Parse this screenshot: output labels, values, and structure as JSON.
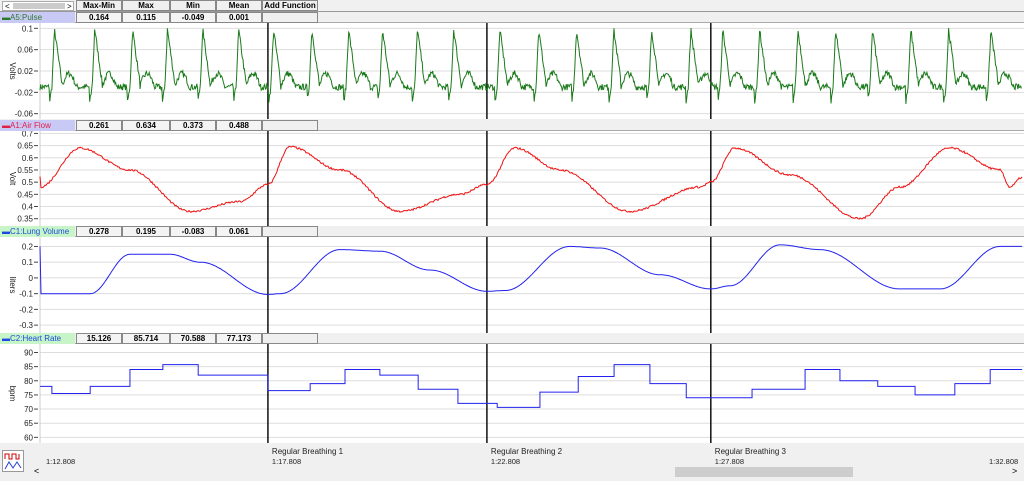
{
  "toolbar": {
    "columns": [
      "Max-Min",
      "Max",
      "Min",
      "Mean",
      "Add Function"
    ],
    "scroll_left": "<",
    "scroll_right": ">"
  },
  "time_range": [
    72.808,
    92.808
  ],
  "channels": [
    {
      "label": "A5:Pulse",
      "label_color": "#2a7a2a",
      "header_bg": "#c9c9f5",
      "values": [
        "0.164",
        "0.115",
        "-0.049",
        "0.001"
      ],
      "unit": "Volts",
      "color": "#1a7a1a",
      "ylim": [
        -0.07,
        0.11
      ],
      "ticks": [
        "0.1",
        "0.06",
        "0.02",
        "-0.02",
        "-0.06"
      ],
      "tick_values": [
        0.1,
        0.06,
        0.02,
        -0.02,
        -0.06
      ],
      "beats": [
        73.05,
        73.87,
        74.64,
        75.35,
        76.07,
        76.8,
        77.51,
        78.29,
        79.04,
        79.73,
        80.44,
        81.18,
        82.12,
        82.91,
        83.68,
        84.44,
        85.21,
        86.01,
        86.66,
        87.41,
        88.19,
        88.96,
        89.71,
        90.49,
        91.26,
        92.12
      ]
    },
    {
      "label": "A1:Air Flow",
      "label_color": "#e0204a",
      "header_bg": "#c9c9f5",
      "values": [
        "0.261",
        "0.634",
        "0.373",
        "0.488"
      ],
      "unit": "Volt",
      "color": "#ee1111",
      "ylim": [
        0.32,
        0.71
      ],
      "ticks": [
        "0.7",
        "0.65",
        "0.6",
        "0.55",
        "0.5",
        "0.45",
        "0.4",
        "0.35"
      ],
      "tick_values": [
        0.7,
        0.65,
        0.6,
        0.55,
        0.5,
        0.45,
        0.4,
        0.35
      ],
      "points": [
        [
          72.81,
          0.48
        ],
        [
          73.62,
          0.64
        ],
        [
          74.64,
          0.55
        ],
        [
          75.86,
          0.38
        ],
        [
          76.88,
          0.42
        ],
        [
          77.45,
          0.49
        ],
        [
          77.9,
          0.645
        ],
        [
          78.92,
          0.55
        ],
        [
          80.14,
          0.38
        ],
        [
          81.36,
          0.45
        ],
        [
          81.91,
          0.49
        ],
        [
          82.48,
          0.64
        ],
        [
          83.4,
          0.55
        ],
        [
          84.82,
          0.38
        ],
        [
          86.25,
          0.48
        ],
        [
          86.47,
          0.5
        ],
        [
          86.96,
          0.64
        ],
        [
          88.08,
          0.53
        ],
        [
          89.51,
          0.35
        ],
        [
          90.32,
          0.48
        ],
        [
          91.34,
          0.64
        ],
        [
          92.36,
          0.55
        ],
        [
          92.56,
          0.48
        ],
        [
          92.81,
          0.52
        ]
      ]
    },
    {
      "label": "C1:Lung Volume",
      "label_color": "#1a4adf",
      "header_bg": "#c8f5c8",
      "values": [
        "0.278",
        "0.195",
        "-0.083",
        "0.061"
      ],
      "unit": "liters",
      "color": "#2222ee",
      "ylim": [
        -0.35,
        0.26
      ],
      "ticks": [
        "0.2",
        "0.1",
        "0",
        "-0.1",
        "-0.2",
        "-0.3"
      ],
      "tick_values": [
        0.2,
        0.1,
        0,
        -0.1,
        -0.2,
        -0.3
      ],
      "points": [
        [
          72.81,
          -0.1
        ],
        [
          73.83,
          -0.1
        ],
        [
          74.64,
          0.15
        ],
        [
          75.46,
          0.15
        ],
        [
          76.07,
          0.1
        ],
        [
          77.45,
          -0.105
        ],
        [
          77.7,
          -0.1
        ],
        [
          78.92,
          0.18
        ],
        [
          79.73,
          0.17
        ],
        [
          80.75,
          0.05
        ],
        [
          81.91,
          -0.085
        ],
        [
          82.28,
          -0.08
        ],
        [
          83.6,
          0.2
        ],
        [
          84.21,
          0.19
        ],
        [
          85.44,
          0.02
        ],
        [
          86.47,
          -0.07
        ],
        [
          86.86,
          -0.05
        ],
        [
          87.88,
          0.21
        ],
        [
          88.69,
          0.18
        ],
        [
          90.32,
          -0.07
        ],
        [
          91.14,
          -0.07
        ],
        [
          92.36,
          0.2
        ],
        [
          92.81,
          0.2
        ]
      ]
    },
    {
      "label": "C2:Heart Rate",
      "label_color": "#1a4adf",
      "header_bg": "#c8f5c8",
      "values": [
        "15.126",
        "85.714",
        "70.588",
        "77.173"
      ],
      "unit": "bpm",
      "color": "#2222ee",
      "ylim": [
        58,
        93
      ],
      "ticks": [
        "90",
        "85",
        "80",
        "75",
        "70",
        "65",
        "60"
      ],
      "tick_values": [
        90,
        85,
        80,
        75,
        70,
        65,
        60
      ],
      "steps": [
        [
          72.81,
          78
        ],
        [
          73.05,
          75.5
        ],
        [
          73.83,
          78
        ],
        [
          74.64,
          84
        ],
        [
          75.31,
          85.7
        ],
        [
          76.03,
          82
        ],
        [
          77.45,
          76.5
        ],
        [
          78.31,
          79
        ],
        [
          79.02,
          84
        ],
        [
          79.73,
          82
        ],
        [
          80.51,
          77
        ],
        [
          81.32,
          72
        ],
        [
          82.12,
          70.6
        ],
        [
          82.99,
          76
        ],
        [
          83.77,
          81.5
        ],
        [
          84.5,
          85.7
        ],
        [
          85.23,
          79
        ],
        [
          85.97,
          74
        ],
        [
          87.31,
          77
        ],
        [
          88.39,
          84
        ],
        [
          89.1,
          80
        ],
        [
          89.87,
          78
        ],
        [
          90.63,
          75
        ],
        [
          91.44,
          79
        ],
        [
          92.16,
          84
        ],
        [
          92.81,
          84
        ]
      ]
    }
  ],
  "markers": [
    {
      "time": 77.45,
      "label": "Regular Breathing 1",
      "time_label": "1:17.808"
    },
    {
      "time": 81.91,
      "label": "Regular Breathing 2",
      "time_label": "1:22.808"
    },
    {
      "time": 86.47,
      "label": "Regular Breathing 3",
      "time_label": "1:27.808"
    }
  ],
  "time_axis": {
    "start": "1:12.808",
    "end": "1:32.808"
  },
  "scrollbar": {
    "left": "<",
    "right": ">",
    "position": 0.77
  }
}
